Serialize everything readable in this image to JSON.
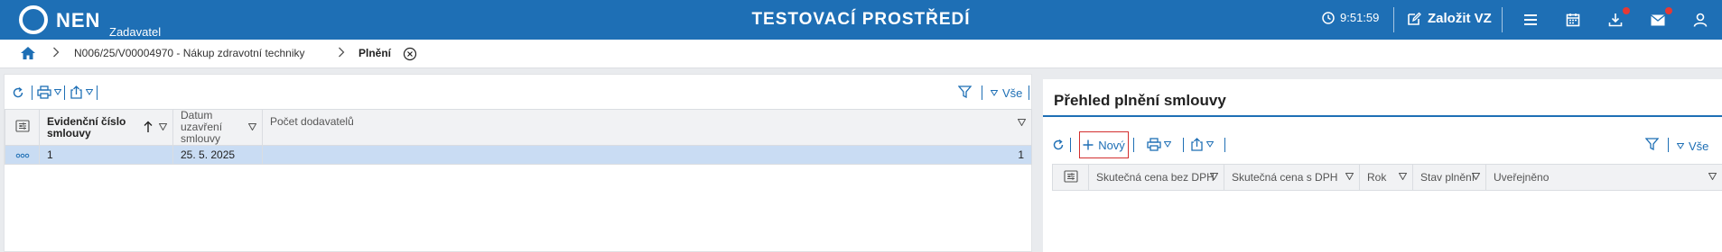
{
  "header": {
    "brand": "NEN",
    "role": "Zadavatel",
    "environment": "TESTOVACÍ PROSTŘEDÍ",
    "time": "9:51:59",
    "create_label": "Založit VZ",
    "colors": {
      "bar": "#1e6fb5",
      "notification_dot": "#e53935"
    },
    "icons": [
      "clock-icon",
      "edit-icon",
      "menu-icon",
      "calendar-icon",
      "download-icon",
      "mail-icon",
      "user-icon"
    ]
  },
  "breadcrumb": {
    "home_icon": "home-icon",
    "items": [
      "N006/25/V00004970 - Nákup zdravotní techniky",
      "Plnění"
    ]
  },
  "left_panel": {
    "filter_label": "Vše",
    "columns": [
      "Evidenční číslo smlouvy",
      "Datum uzavření smlouvy",
      "Počet dodavatelů"
    ],
    "rows": [
      {
        "evidencni_cislo": "1",
        "datum": "25. 5. 2025",
        "pocet": "1"
      }
    ]
  },
  "right_panel": {
    "title": "Přehled plnění smlouvy",
    "new_label": "Nový",
    "filter_label": "Vše",
    "columns": [
      "Skutečná cena bez DPH",
      "Skutečná cena s DPH",
      "Rok",
      "Stav plnění",
      "Uveřejněno"
    ]
  }
}
